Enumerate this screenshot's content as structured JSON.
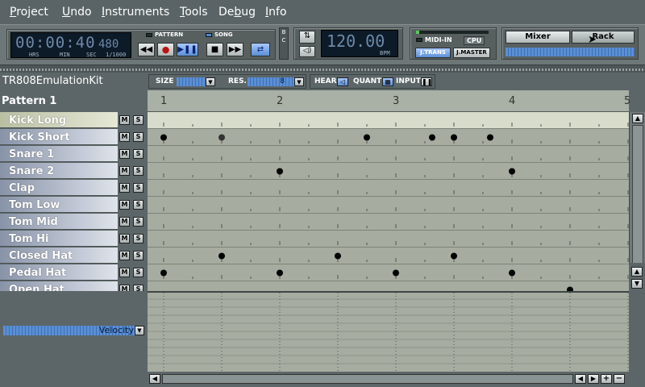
{
  "menu": {
    "project": {
      "u": "P",
      "rest": "roject"
    },
    "undo": {
      "u": "U",
      "rest": "ndo"
    },
    "instruments": {
      "u": "I",
      "rest": "nstruments"
    },
    "tools": {
      "u": "T",
      "rest": "ools"
    },
    "debug": {
      "u": "b",
      "pre": "De",
      "rest": "ug"
    },
    "info": {
      "u": "I",
      "rest": "nfo"
    }
  },
  "transport": {
    "time": "00:00:40",
    "time_ms": "480",
    "hrs_label": "HRS",
    "min_label": "MIN",
    "sec_label": "SEC",
    "ms_label": "1/1000",
    "pattern_label": "PATTERN",
    "song_label": "SONG",
    "rewind_icon": "rewind-icon",
    "record_icon": "record-icon",
    "play_icon": "play-pause-icon",
    "stop_icon": "stop-icon",
    "ff_icon": "fast-forward-icon",
    "loop_icon": "loop-icon",
    "bc_label_b": "B",
    "bc_label_c": "C"
  },
  "bpm": {
    "value": "120.00",
    "label": "BPM"
  },
  "midi": {
    "midi_in": "MIDI-IN",
    "cpu": "CPU",
    "jtrans": "J.TRANS",
    "jmaster": "J.MASTER"
  },
  "views": {
    "mixer": "Mixer",
    "rack": "Rack"
  },
  "kit": {
    "name": "TR808EmulationKit",
    "size_label": "SIZE",
    "size_value": "8",
    "res_label": "RES.",
    "res_value": "8",
    "hear_label": "HEAR",
    "quant_label": "QUANT",
    "input_label": "INPUT"
  },
  "pattern": {
    "name": "Pattern 1",
    "beats": [
      "1",
      "2",
      "3",
      "4",
      "5"
    ]
  },
  "tracks": [
    {
      "name": "Kick Long",
      "m": "M",
      "s": "S"
    },
    {
      "name": "Kick Short",
      "m": "M",
      "s": "S"
    },
    {
      "name": "Snare 1",
      "m": "M",
      "s": "S"
    },
    {
      "name": "Snare 2",
      "m": "M",
      "s": "S"
    },
    {
      "name": "Clap",
      "m": "M",
      "s": "S"
    },
    {
      "name": "Tom Low",
      "m": "M",
      "s": "S"
    },
    {
      "name": "Tom Mid",
      "m": "M",
      "s": "S"
    },
    {
      "name": "Tom Hi",
      "m": "M",
      "s": "S"
    },
    {
      "name": "Closed Hat",
      "m": "M",
      "s": "S"
    },
    {
      "name": "Pedal Hat",
      "m": "M",
      "s": "S"
    },
    {
      "name": "Open Hat",
      "m": "M",
      "s": "S"
    }
  ],
  "notes": [
    {
      "track": 1,
      "beat": 1.0
    },
    {
      "track": 1,
      "beat": 1.5
    },
    {
      "track": 1,
      "beat": 2.75
    },
    {
      "track": 1,
      "beat": 3.3125
    },
    {
      "track": 1,
      "beat": 3.5
    },
    {
      "track": 1,
      "beat": 3.8125
    },
    {
      "track": 3,
      "beat": 2.0
    },
    {
      "track": 3,
      "beat": 4.0
    },
    {
      "track": 8,
      "beat": 1.5
    },
    {
      "track": 8,
      "beat": 2.5
    },
    {
      "track": 8,
      "beat": 3.5
    },
    {
      "track": 9,
      "beat": 1.0
    },
    {
      "track": 9,
      "beat": 2.0
    },
    {
      "track": 9,
      "beat": 3.0
    },
    {
      "track": 9,
      "beat": 4.0
    },
    {
      "track": 10,
      "beat": 4.5
    }
  ],
  "velocity": {
    "label": "Velocity"
  },
  "colors": {
    "grid": "#a6aca0",
    "accent_blue": "#5b8fd4",
    "lcd": "#0d1a28"
  }
}
